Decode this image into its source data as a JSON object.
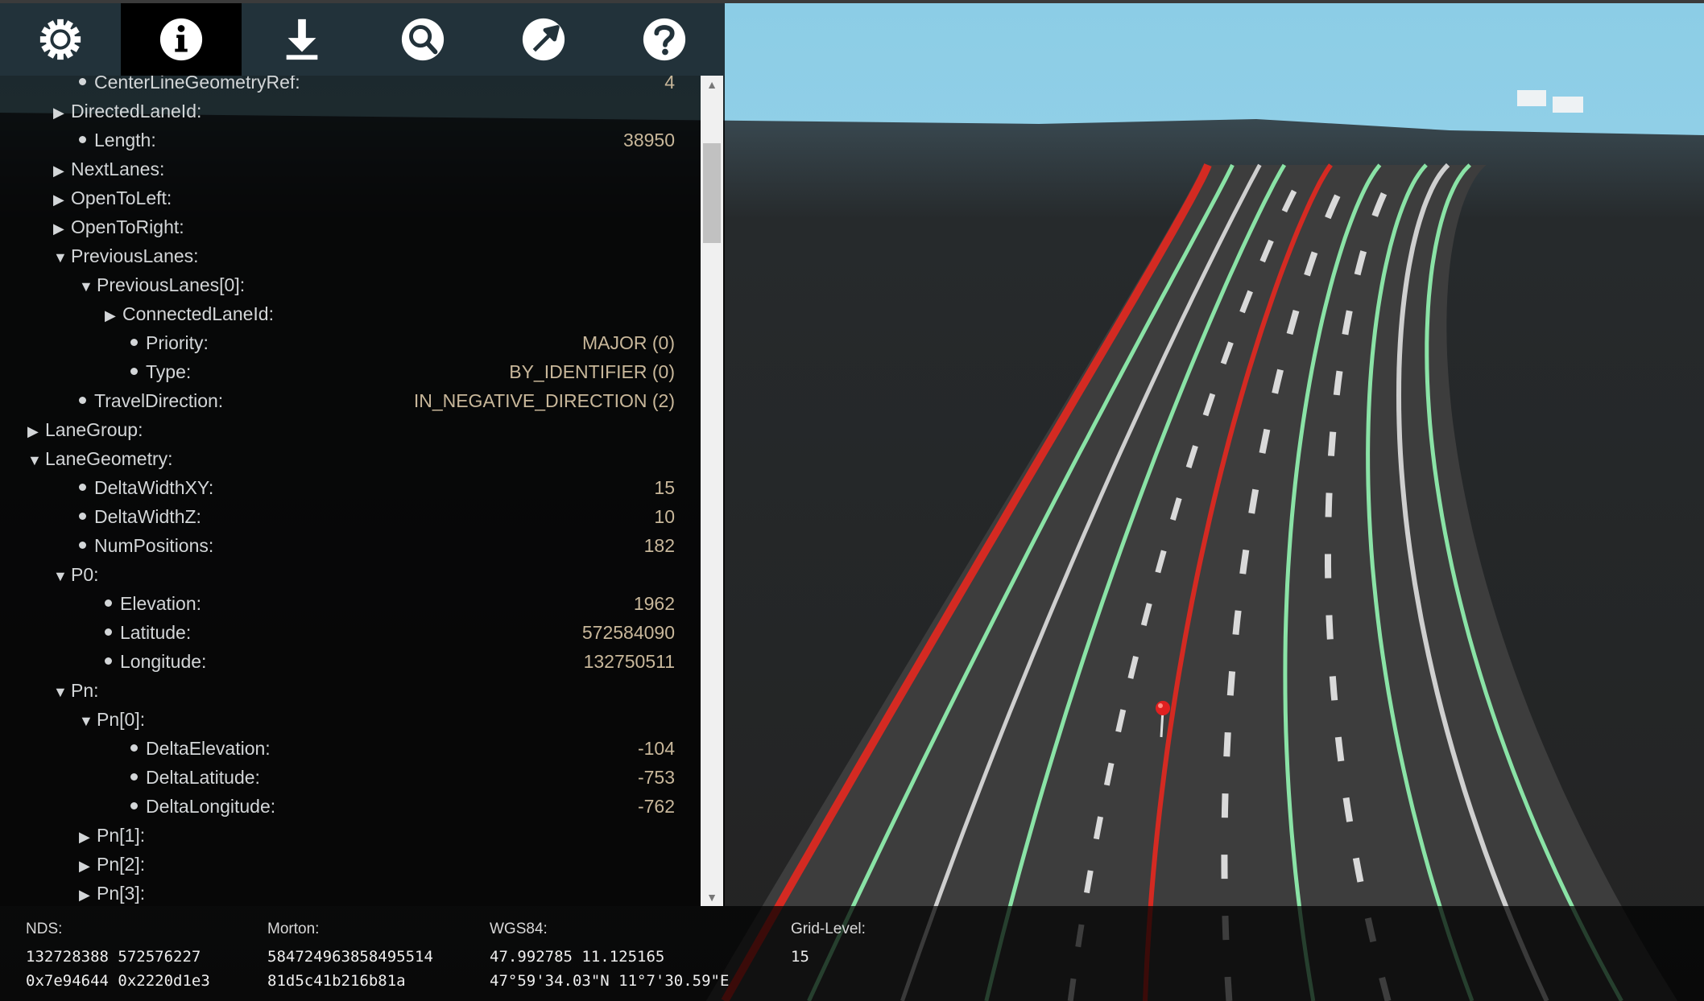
{
  "toolbar": {
    "buttons": [
      {
        "icon": "gear-icon",
        "active": false
      },
      {
        "icon": "info-icon",
        "active": true
      },
      {
        "icon": "download-icon",
        "active": false
      },
      {
        "icon": "search-icon",
        "active": false
      },
      {
        "icon": "jump-icon",
        "active": false
      },
      {
        "icon": "help-icon",
        "active": false
      }
    ]
  },
  "tree": [
    {
      "level": 2,
      "kind": "leaf",
      "label": "CenterLineGeometryRef:",
      "value": "4"
    },
    {
      "level": 2,
      "kind": "collapsed",
      "label": "DirectedLaneId:",
      "value": ""
    },
    {
      "level": 2,
      "kind": "leaf",
      "label": "Length:",
      "value": "38950"
    },
    {
      "level": 2,
      "kind": "collapsed",
      "label": "NextLanes:",
      "value": ""
    },
    {
      "level": 2,
      "kind": "collapsed",
      "label": "OpenToLeft:",
      "value": ""
    },
    {
      "level": 2,
      "kind": "collapsed",
      "label": "OpenToRight:",
      "value": ""
    },
    {
      "level": 2,
      "kind": "expanded",
      "label": "PreviousLanes:",
      "value": ""
    },
    {
      "level": 3,
      "kind": "expanded",
      "label": "PreviousLanes[0]:",
      "value": ""
    },
    {
      "level": 4,
      "kind": "collapsed",
      "label": "ConnectedLaneId:",
      "value": ""
    },
    {
      "level": 4,
      "kind": "leaf",
      "label": "Priority:",
      "value": "MAJOR (0)"
    },
    {
      "level": 4,
      "kind": "leaf",
      "label": "Type:",
      "value": "BY_IDENTIFIER (0)"
    },
    {
      "level": 2,
      "kind": "leaf",
      "label": "TravelDirection:",
      "value": "IN_NEGATIVE_DIRECTION (2)"
    },
    {
      "level": 1,
      "kind": "collapsed",
      "label": "LaneGroup:",
      "value": ""
    },
    {
      "level": 1,
      "kind": "expanded",
      "label": "LaneGeometry:",
      "value": ""
    },
    {
      "level": 2,
      "kind": "leaf",
      "label": "DeltaWidthXY:",
      "value": "15"
    },
    {
      "level": 2,
      "kind": "leaf",
      "label": "DeltaWidthZ:",
      "value": "10"
    },
    {
      "level": 2,
      "kind": "leaf",
      "label": "NumPositions:",
      "value": "182"
    },
    {
      "level": 2,
      "kind": "expanded",
      "label": "P0:",
      "value": ""
    },
    {
      "level": 3,
      "kind": "leaf",
      "label": "Elevation:",
      "value": "1962"
    },
    {
      "level": 3,
      "kind": "leaf",
      "label": "Latitude:",
      "value": "572584090"
    },
    {
      "level": 3,
      "kind": "leaf",
      "label": "Longitude:",
      "value": "132750511"
    },
    {
      "level": 2,
      "kind": "expanded",
      "label": "Pn:",
      "value": ""
    },
    {
      "level": 3,
      "kind": "expanded",
      "label": "Pn[0]:",
      "value": ""
    },
    {
      "level": 4,
      "kind": "leaf",
      "label": "DeltaElevation:",
      "value": "-104"
    },
    {
      "level": 4,
      "kind": "leaf",
      "label": "DeltaLatitude:",
      "value": "-753"
    },
    {
      "level": 4,
      "kind": "leaf",
      "label": "DeltaLongitude:",
      "value": "-762"
    },
    {
      "level": 3,
      "kind": "collapsed",
      "label": "Pn[1]:",
      "value": ""
    },
    {
      "level": 3,
      "kind": "collapsed",
      "label": "Pn[2]:",
      "value": ""
    },
    {
      "level": 3,
      "kind": "collapsed",
      "label": "Pn[3]:",
      "value": ""
    }
  ],
  "status": {
    "nds": {
      "label": "NDS:",
      "line1": "132728388 572576227",
      "line2": "0x7e94644 0x2220d1e3"
    },
    "morton": {
      "label": "Morton:",
      "line1": "584724963858495514",
      "line2": "81d5c41b216b81a"
    },
    "wgs84": {
      "label": "WGS84:",
      "line1": "47.992785 11.125165",
      "line2": "47°59'34.03\"N 11°7'30.59\"E"
    },
    "grid": {
      "label": "Grid-Level:",
      "line1": "15"
    }
  },
  "colors": {
    "sky": "#8ecde6",
    "road": "#3d3d3d",
    "selected_lane_marking": "#d42a22",
    "green_marking": "#8ae3a6",
    "white_marking": "#cfcfcf",
    "pin": "#e02020"
  }
}
